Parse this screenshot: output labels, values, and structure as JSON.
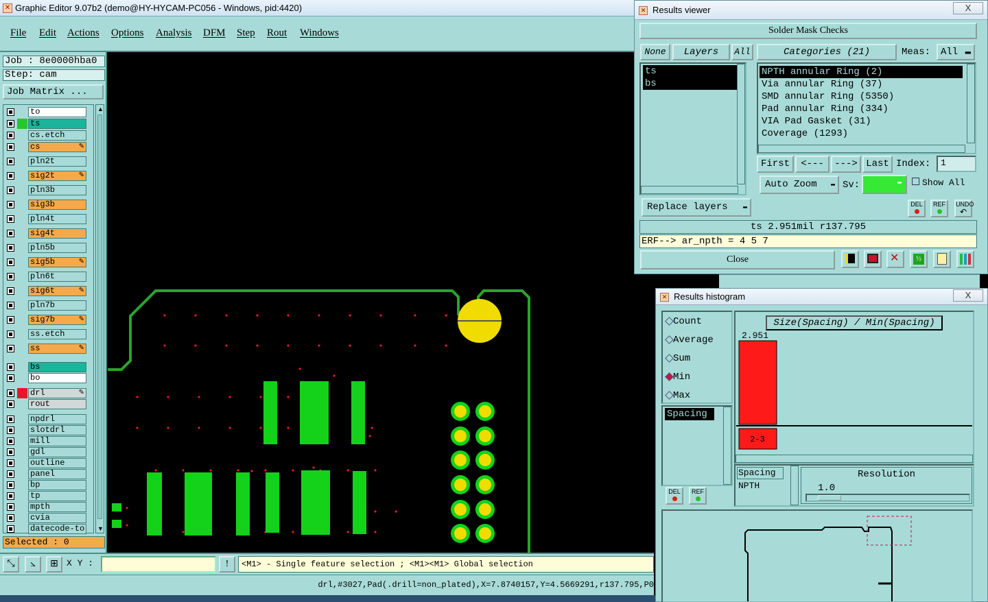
{
  "main_window": {
    "title": "Graphic Editor 9.07b2 (demo@HY-HYCAM-PC056 - Windows, pid:4420)",
    "menu": [
      "File",
      "Edit",
      "Actions",
      "Options",
      "Analysis",
      "DFM",
      "Step",
      "Rout",
      "Windows"
    ],
    "job_label": "Job : 8e0000hba0",
    "step_label": "Step: cam",
    "job_matrix_button": "Job Matrix ...",
    "layers": [
      {
        "name": "to",
        "style": "white",
        "swatch": ""
      },
      {
        "name": "ts",
        "style": "green",
        "swatch": "#27c72f"
      },
      {
        "name": "cs.etch",
        "style": "plain",
        "swatch": ""
      },
      {
        "name": "cs",
        "style": "orange",
        "swatch": "",
        "edit": true
      },
      {
        "name": "pln2t",
        "style": "plain",
        "swatch": ""
      },
      {
        "name": "sig2t",
        "style": "orange",
        "swatch": "",
        "edit": true
      },
      {
        "name": "pln3b",
        "style": "plain",
        "swatch": ""
      },
      {
        "name": "sig3b",
        "style": "orange",
        "swatch": ""
      },
      {
        "name": "pln4t",
        "style": "plain",
        "swatch": ""
      },
      {
        "name": "sig4t",
        "style": "orange",
        "swatch": ""
      },
      {
        "name": "pln5b",
        "style": "plain",
        "swatch": ""
      },
      {
        "name": "sig5b",
        "style": "orange",
        "swatch": "",
        "edit": true
      },
      {
        "name": "pln6t",
        "style": "plain",
        "swatch": ""
      },
      {
        "name": "sig6t",
        "style": "orange",
        "swatch": "",
        "edit": true
      },
      {
        "name": "pln7b",
        "style": "plain",
        "swatch": ""
      },
      {
        "name": "sig7b",
        "style": "orange",
        "swatch": "",
        "edit": true
      },
      {
        "name": "ss.etch",
        "style": "plain",
        "swatch": ""
      },
      {
        "name": "ss",
        "style": "orange",
        "swatch": "",
        "edit": true
      },
      {
        "name": "bs",
        "style": "green",
        "swatch": ""
      },
      {
        "name": "bo",
        "style": "white",
        "swatch": ""
      },
      {
        "name": "drl",
        "style": "grey",
        "swatch": "#e8162a",
        "edit": true
      },
      {
        "name": "rout",
        "style": "grey",
        "swatch": ""
      },
      {
        "name": "npdrl",
        "style": "plain",
        "swatch": ""
      },
      {
        "name": "slotdrl",
        "style": "plain",
        "swatch": ""
      },
      {
        "name": "mill",
        "style": "plain",
        "swatch": ""
      },
      {
        "name": "gdl",
        "style": "plain",
        "swatch": ""
      },
      {
        "name": "outline",
        "style": "plain",
        "swatch": ""
      },
      {
        "name": "panel",
        "style": "plain",
        "swatch": ""
      },
      {
        "name": "bp",
        "style": "plain",
        "swatch": ""
      },
      {
        "name": "tp",
        "style": "plain",
        "swatch": ""
      },
      {
        "name": "mpth",
        "style": "plain",
        "swatch": ""
      },
      {
        "name": "cvia",
        "style": "plain",
        "swatch": ""
      },
      {
        "name": "datecode-to",
        "style": "plain",
        "swatch": ""
      }
    ],
    "selected_label": "Selected : 0",
    "xy_label": "X Y :",
    "xy_value": "",
    "hint": "<M1> - Single feature selection ; <M1><M1> Global selection",
    "status": "drl,#3027,Pad(.drill=non_plated),X=7.8740157,Y=4.5669291,r137.795,P0"
  },
  "results_viewer": {
    "title": "Results viewer",
    "close_x": "X",
    "header": "Solder Mask Checks",
    "none_btn": "None",
    "layers_btn": "Layers",
    "all_btn": "All",
    "layers": [
      {
        "name": "ts"
      },
      {
        "name": "bs"
      }
    ],
    "categories_label": "Categories (21)",
    "meas_label": "Meas:",
    "meas_value": "All",
    "categories": [
      {
        "label": "NPTH annular Ring (2)",
        "selected": true
      },
      {
        "label": "Via annular Ring (37)",
        "selected": false
      },
      {
        "label": "SMD annular Ring (5350)",
        "selected": false
      },
      {
        "label": "Pad annular Ring (334)",
        "selected": false
      },
      {
        "label": "VIA Pad Gasket (31)",
        "selected": false
      },
      {
        "label": "Coverage (1293)",
        "selected": false
      }
    ],
    "first_btn": "First",
    "prev_btn": "<---",
    "next_btn": "--->",
    "last_btn": "Last",
    "index_label": "Index:",
    "index_value": "1",
    "auto_zoom": "Auto Zoom",
    "sv_label": "Sv:",
    "show_all": "Show All",
    "replace_layers": "Replace layers",
    "del_label": "DEL",
    "ref_label": "REF",
    "undo_label": "UNDO",
    "measure_line": "ts 2.951mil  r137.795",
    "erf_line": "ERF--> ar_npth = 4 5 7",
    "close_btn": "Close"
  },
  "histogram": {
    "title": "Results histogram",
    "close_x": "X",
    "modes": [
      {
        "label": "Count",
        "on": false
      },
      {
        "label": "Average",
        "on": false
      },
      {
        "label": "Sum",
        "on": false
      },
      {
        "label": "Min",
        "on": true
      },
      {
        "label": "Max",
        "on": false
      }
    ],
    "list_item": "Spacing",
    "del_label": "DEL",
    "ref_label": "REF",
    "chart_title": "Size(Spacing) / Min(Spacing)",
    "bar_value": "2.951",
    "bar_bin": "2-3",
    "table_head": "Spacing",
    "table_row": "NPTH",
    "resolution_label": "Resolution",
    "resolution_value": "1.0",
    "accent_red": "#ff1a1a"
  },
  "chart_data": {
    "type": "bar",
    "title": "Size(Spacing) / Min(Spacing)",
    "categories": [
      "2-3"
    ],
    "values": [
      2.951
    ]
  },
  "colors": {
    "panel": "#a8dbd8",
    "pad_green": "#14d21a",
    "outline_green": "#2aa42a",
    "hole_yellow": "#f0dc00",
    "drill_red": "#e8162a"
  }
}
